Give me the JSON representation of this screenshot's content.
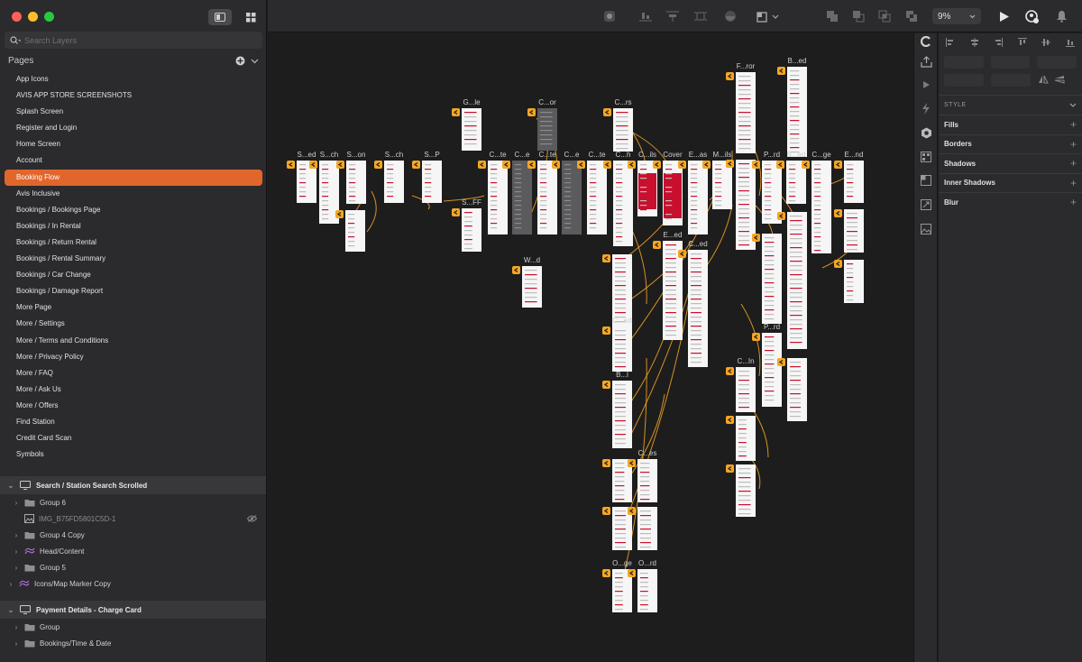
{
  "layers_search": {
    "placeholder": "Search Layers"
  },
  "pages": {
    "title": "Pages",
    "items": [
      "App Icons",
      "AVIS APP STORE SCREENSHOTS",
      "Splash Screen",
      "Register and Login",
      "Home Screen",
      "Account",
      "Booking Flow",
      "Avis Inclusive",
      "Bookings / Bookings Page",
      "Bookings / In Rental",
      "Bookings / Return Rental",
      "Bookings / Rental Summary",
      "Bookings / Car Change",
      "Bookings / Damage Report",
      "More Page",
      "More / Settings",
      "More / Terms and Conditions",
      "More / Privacy Policy",
      "More / FAQ",
      "More / Ask Us",
      "More / Offers",
      "Find Station",
      "Credit Card Scan",
      "Symbols"
    ],
    "active_index": 6
  },
  "layers": {
    "artboard1": {
      "name": "Search / Station Search Scrolled",
      "children": [
        "Group 6",
        "IMG_B75FD5801C5D-1",
        "Group 4 Copy",
        "Head/Content",
        "Group 5",
        "Icons/Map Marker Copy"
      ]
    },
    "artboard2": {
      "name": "Payment Details - Charge Card",
      "children": [
        "Group",
        "Bookings/Time & Date"
      ]
    }
  },
  "toolbar": {
    "zoom": "9%"
  },
  "artboards": {
    "labels": [
      "S...ed",
      "S...ch",
      "S...on",
      "S...ch",
      "S...P",
      "G...le",
      "C...or",
      "S...FF",
      "C...te",
      "C...e",
      "C...te",
      "C...e",
      "C...te",
      "C...rs",
      "C...h",
      "C...ils",
      "Cover",
      "E...as",
      "M...ils",
      "F...ror",
      "B...ed",
      "P...rd",
      "B...ed",
      "C...ge",
      "E...nd",
      "W...d",
      "C...ed",
      "E...ed",
      "C...ed",
      "B...l",
      "C...es",
      "C...In",
      "P...rd",
      "O...ge",
      "O...rd"
    ]
  },
  "inspector": {
    "style_title": "STYLE",
    "rows": [
      "Fills",
      "Borders",
      "Shadows",
      "Inner Shadows",
      "Blur"
    ]
  },
  "colors": {
    "accent": "#e0662c",
    "marker": "#f5a623",
    "canvas": "#1d1d1d",
    "panel": "#2b2a2c"
  }
}
